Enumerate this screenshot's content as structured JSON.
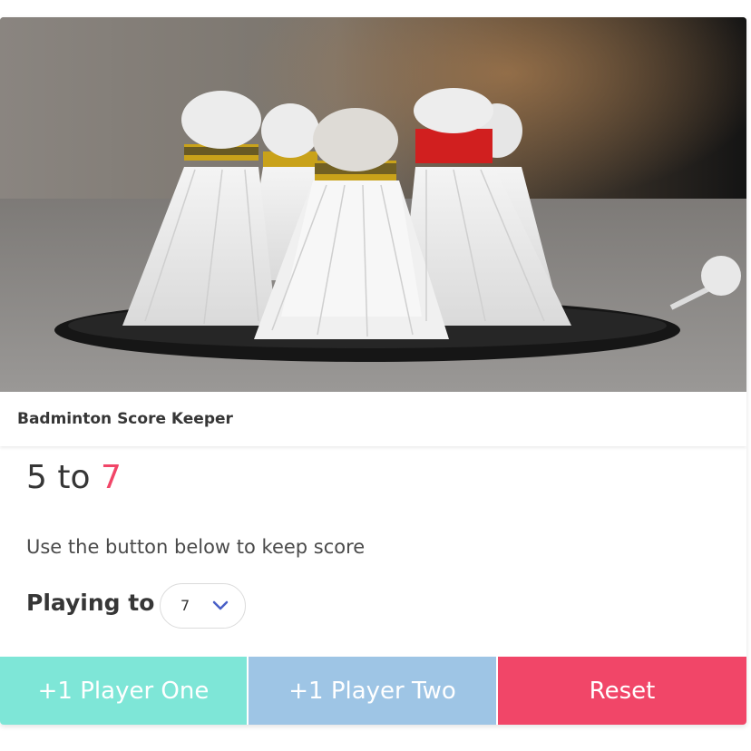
{
  "header": {
    "title": "Badminton Score Keeper"
  },
  "score": {
    "player_one": "5",
    "separator": " to ",
    "player_two": "7"
  },
  "subtitle": "Use the button below to keep score",
  "playing_to": {
    "label": "Playing to",
    "selected": "7",
    "arrow_icon": "chevron-down-icon",
    "arrow_color": "#485fc7"
  },
  "buttons": {
    "player_one": "+1 Player One",
    "player_two": "+1 Player Two",
    "reset": "Reset"
  },
  "colors": {
    "player_one_button": "#7ee6d7",
    "player_two_button": "#9ec5e5",
    "reset_button": "#f14668",
    "player_two_score": "#f14668"
  }
}
